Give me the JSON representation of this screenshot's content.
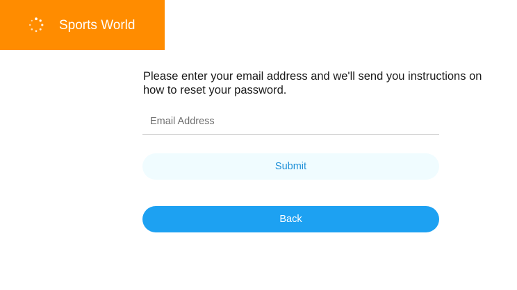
{
  "header": {
    "brand_name": "Sports World",
    "logo_icon": "loading-dots-icon",
    "brand_color": "#ff8c00"
  },
  "form": {
    "instructions": "Please enter your email address and we'll send you instructions on how to reset your password.",
    "email_placeholder": "Email Address",
    "email_value": "",
    "submit_label": "Submit",
    "back_label": "Back"
  },
  "colors": {
    "submit_background": "#f0fcff",
    "submit_text": "#1e90d8",
    "back_background": "#1da1f2",
    "back_text": "#ffffff"
  }
}
